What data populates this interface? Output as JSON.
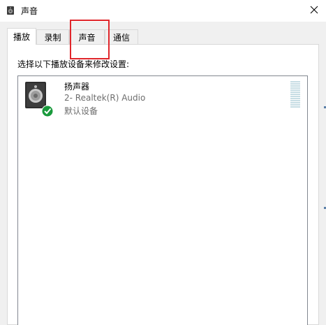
{
  "window": {
    "title": "声音",
    "icon": "speaker-icon",
    "close_icon": "close-icon"
  },
  "tabs": [
    {
      "label": "播放",
      "active": true
    },
    {
      "label": "录制",
      "active": false
    },
    {
      "label": "声音",
      "active": false
    },
    {
      "label": "通信",
      "active": false
    }
  ],
  "playback": {
    "instruction": "选择以下播放设备来修改设置:",
    "devices": [
      {
        "name": "扬声器",
        "description": "2- Realtek(R) Audio",
        "status": "默认设备",
        "icon": "speaker-device-icon",
        "default_badge": "green-check-icon"
      }
    ]
  },
  "colors": {
    "highlight": "#e0262b",
    "default_badge": "#1a9a3c",
    "level_meter": "#c7dde4"
  }
}
